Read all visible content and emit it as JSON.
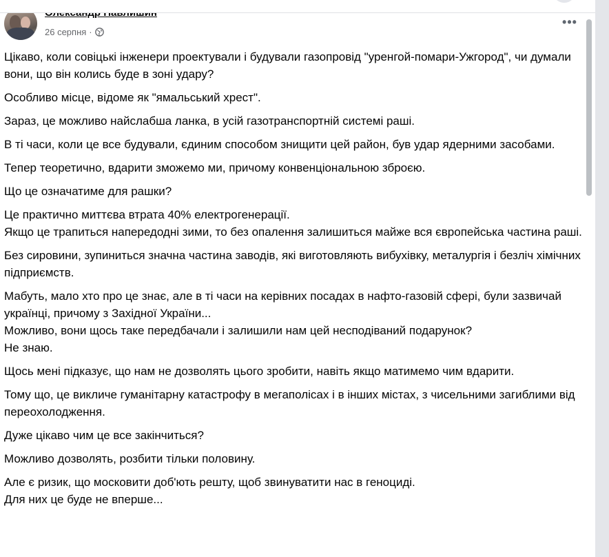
{
  "post": {
    "author_name": "Олександр Павлишин",
    "date": "26 серпня",
    "separator": "·",
    "privacy_icon": "globe-icon",
    "more_icon": "more-options-icon",
    "more_label": "•••",
    "paragraphs": [
      "Цікаво, коли совіцькі інженери проектували і будували газопровід \"уренгой-помари-Ужгород\", чи думали вони, що він колись буде в зоні удару?",
      "Особливо місце, відоме як \"ямальський хрест\".",
      "Зараз, це можливо найслабша ланка, в усій газотранспортній системі раші.",
      "В ті часи, коли це все будували, єдиним способом знищити цей район, був удар ядерними засобами.",
      "Тепер теоретично, вдарити зможемо ми, причому конвенціональною зброєю.",
      "Що це означатиме для рашки?",
      "Це практично миттєва втрата 40% електрогенерації.\nЯкщо це трапиться напередодні зими, то без опалення залишиться майже вся європейська частина раші.",
      "Без сировини, зупиниться значна частина заводів, які виготовляють вибухівку, металургія і безліч хімічних підприємств.",
      "Мабуть, мало хто про це знає, але в ті часи на керівних посадах в нафто-газовій сфері, були зазвичай українці, причому з Західної України...\nМожливо, вони щось таке передбачали і залишили нам цей несподіваний подарунок?\nНе знаю.",
      "Щось мені підказує, що нам не дозволять цього зробити, навіть якщо матимемо чим вдарити.",
      "Тому що, це викличе гуманітарну катастрофу в мегаполісах і в інших містах, з чисельними загиблими від переохолодження.",
      "Дуже цікаво чим це все закінчиться?",
      "Можливо дозволять, розбити тільки половину.",
      "Але є ризик, що московити доб'ють решту,  щоб звинуватити нас в геноциді.\nДля них це буде не вперше..."
    ]
  },
  "colors": {
    "text": "#050505",
    "secondary_text": "#65676b",
    "page_background": "#e4e6ea",
    "card_background": "#ffffff",
    "scrollbar_thumb": "#bcc0c4"
  }
}
